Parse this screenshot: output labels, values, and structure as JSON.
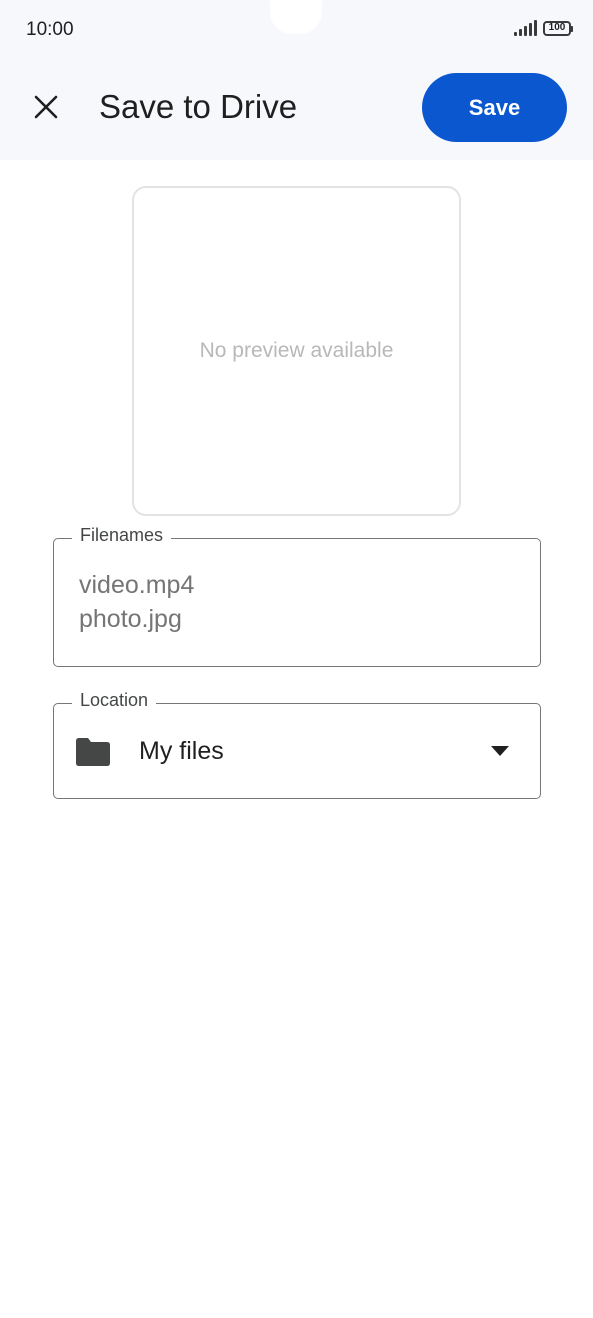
{
  "status_bar": {
    "time": "10:00",
    "battery": "100"
  },
  "app_bar": {
    "close_icon": "close-icon",
    "title": "Save to Drive",
    "save_label": "Save"
  },
  "preview": {
    "text": "No preview available"
  },
  "filenames": {
    "label": "Filenames",
    "items": [
      "video.mp4",
      "photo.jpg"
    ]
  },
  "location": {
    "label": "Location",
    "icon": "folder-icon",
    "value": "My files",
    "dropdown_icon": "dropdown-arrow-icon"
  },
  "colors": {
    "accent": "#0b57d0",
    "top_bar_background": "#f7f8fc",
    "outline": "#747775",
    "preview_border": "#e3e3e3"
  }
}
